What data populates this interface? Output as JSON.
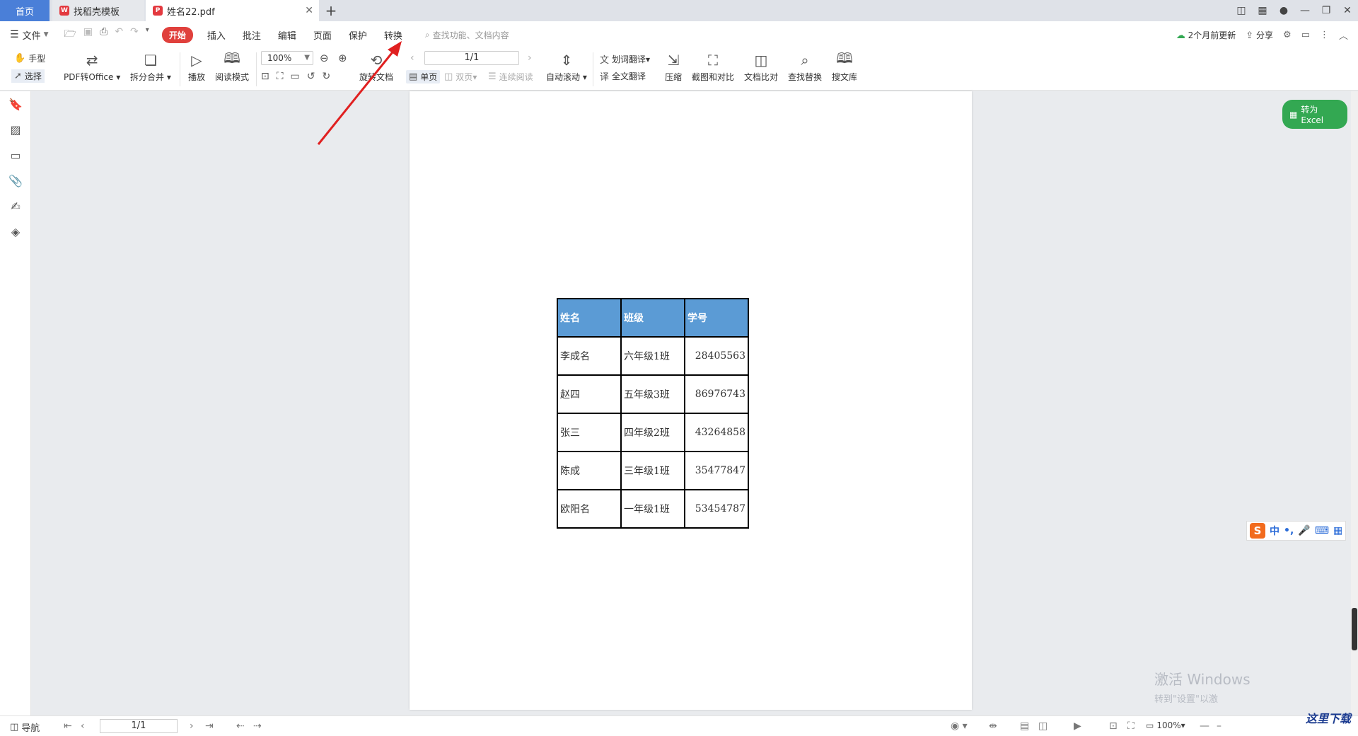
{
  "tabs": [
    {
      "label": "首页"
    },
    {
      "label": "找稻壳模板"
    },
    {
      "label": "姓名22.pdf"
    }
  ],
  "menu": {
    "file": "文件",
    "start": "开始",
    "items": [
      "插入",
      "批注",
      "编辑",
      "页面",
      "保护",
      "转换"
    ],
    "search_placeholder": "查找功能、文档内容",
    "update_status": "2个月前更新",
    "share": "分享"
  },
  "ribbon": {
    "hand": "手型",
    "select": "选择",
    "pdf_to_office": "PDF转Office",
    "split_merge": "拆分合并",
    "play": "播放",
    "read_mode": "阅读模式",
    "zoom": "100%",
    "rotate_doc": "旋转文档",
    "page_indicator": "1/1",
    "single_page": "单页",
    "double_page": "双页",
    "continuous_read": "连续阅读",
    "auto_scroll": "自动滚动",
    "word_translate": "划词翻译",
    "full_translate": "全文翻译",
    "compress": "压缩",
    "screenshot_compare": "截图和对比",
    "doc_compare": "文档比对",
    "find_replace": "查找替换",
    "search_library": "搜文库"
  },
  "document": {
    "table": {
      "headers": [
        "姓名",
        "班级",
        "学号"
      ],
      "rows": [
        [
          "李成名",
          "六年级1班",
          "28405563"
        ],
        [
          "赵四",
          "五年级3班",
          "86976743"
        ],
        [
          "张三",
          "四年级2班",
          "43264858"
        ],
        [
          "陈成",
          "三年级1班",
          "35477847"
        ],
        [
          "欧阳名",
          "一年级1班",
          "53454787"
        ]
      ]
    }
  },
  "side_actions": {
    "to_excel": "转为Excel"
  },
  "ime": {
    "mode": "中"
  },
  "activation": {
    "line1": "激活 Windows",
    "line2": "转到\"设置\"以激"
  },
  "statusbar": {
    "nav": "导航",
    "page": "1/1",
    "zoom": "100%"
  },
  "corner_logo": "这里下载",
  "colors": {
    "accent": "#e0403c",
    "header_fill": "#5b9bd5",
    "excel_button": "#33a852",
    "annotation_arrow": "#e02020"
  }
}
